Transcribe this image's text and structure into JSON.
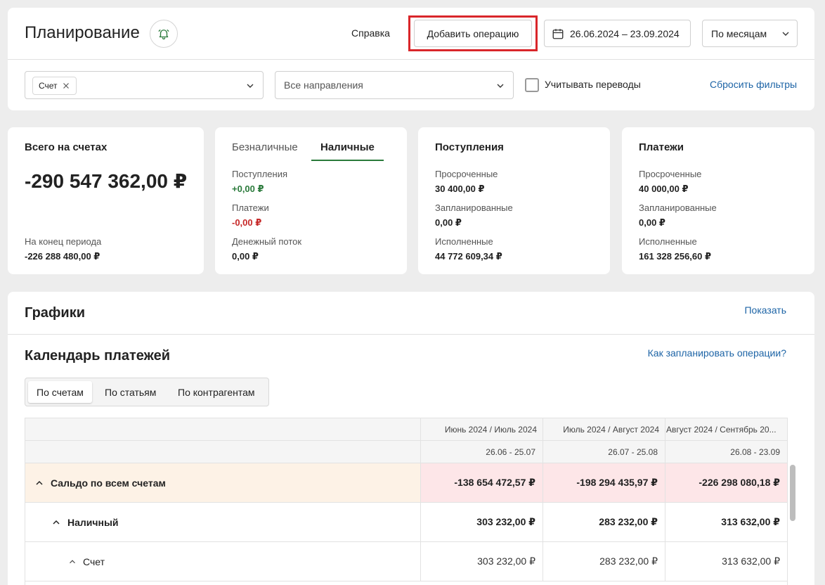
{
  "header": {
    "title": "Планирование",
    "help_label": "Справка",
    "add_button_label": "Добавить операцию",
    "date_range": "26.06.2024 – 23.09.2024",
    "period_select": "По месяцам"
  },
  "filters": {
    "account_chip": "Счет",
    "directions_placeholder": "Все направления",
    "transfers_checkbox_label": "Учитывать переводы",
    "transfers_checked": false,
    "reset_label": "Сбросить фильтры"
  },
  "summary": {
    "total": {
      "title": "Всего на счетах",
      "value": "-290 547 362,00 ₽",
      "end_label": "На конец периода",
      "end_value": "-226 288 480,00 ₽"
    },
    "payment_types": {
      "tab_noncash": "Безналичные",
      "tab_cash": "Наличные",
      "active_tab": "Наличные",
      "income_label": "Поступления",
      "income_value": "+0,00 ₽",
      "payments_label": "Платежи",
      "payments_value": "-0,00 ₽",
      "cashflow_label": "Денежный поток",
      "cashflow_value": "0,00 ₽"
    },
    "income": {
      "title": "Поступления",
      "overdue_label": "Просроченные",
      "overdue_value": "30 400,00 ₽",
      "planned_label": "Запланированные",
      "planned_value": "0,00 ₽",
      "done_label": "Исполненные",
      "done_value": "44 772 609,34 ₽"
    },
    "payments": {
      "title": "Платежи",
      "overdue_label": "Просроченные",
      "overdue_value": "40 000,00 ₽",
      "planned_label": "Запланированные",
      "planned_value": "0,00 ₽",
      "done_label": "Исполненные",
      "done_value": "161 328 256,60 ₽"
    }
  },
  "charts": {
    "title": "Графики",
    "show_label": "Показать",
    "calendar_title": "Календарь платежей",
    "how_to_link": "Как запланировать операции?",
    "tabs": [
      {
        "label": "По счетам",
        "active": true
      },
      {
        "label": "По статьям",
        "active": false
      },
      {
        "label": "По контрагентам",
        "active": false
      }
    ]
  },
  "table": {
    "periods": [
      {
        "month": "Июнь 2024 / Июль 2024",
        "range": "26.06 - 25.07"
      },
      {
        "month": "Июль 2024 / Август 2024",
        "range": "26.07 - 25.08"
      },
      {
        "month": "Август 2024 / Сентябрь 20...",
        "range": "26.08 - 23.09"
      }
    ],
    "rows": [
      {
        "label": "Сальдо по всем счетам",
        "values": [
          "-138 654 472,57 ₽",
          "-198 294 435,97 ₽",
          "-226 298 080,18 ₽"
        ]
      },
      {
        "label": "Наличный",
        "values": [
          "303 232,00 ₽",
          "283 232,00 ₽",
          "313 632,00 ₽"
        ]
      },
      {
        "label": "Счет",
        "values": [
          "303 232,00 ₽",
          "283 232,00 ₽",
          "313 632,00 ₽"
        ]
      }
    ]
  },
  "colors": {
    "accent_green": "#2a7a3b",
    "link_blue": "#1d64a6",
    "highlight_red": "#d9262a",
    "saldo_row_bg": "#fdf2e6",
    "negative_cell_bg": "#fde6e8"
  },
  "icons": {
    "bell": "bell-icon",
    "calendar": "calendar-icon",
    "chevron": "chevron-down-icon",
    "collapse": "chevron-up-icon",
    "remove_chip": "close-icon"
  }
}
